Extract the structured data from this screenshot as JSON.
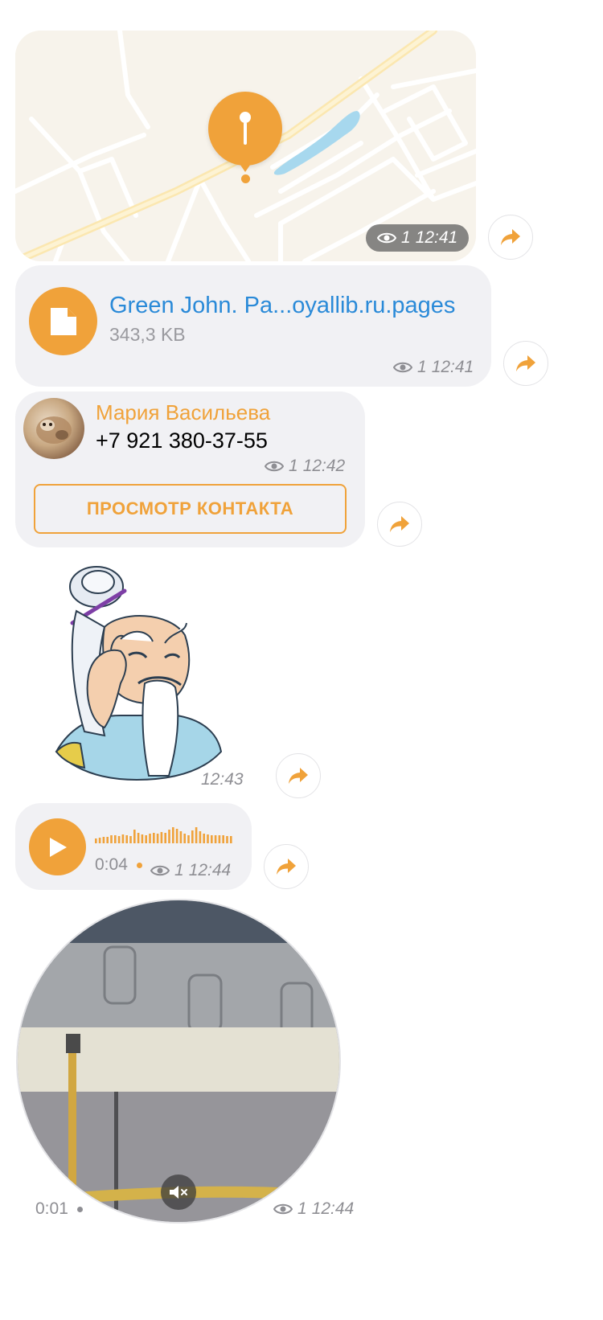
{
  "colors": {
    "accent": "#f0a23a",
    "link": "#2a8ad8",
    "bubble": "#f1f1f4",
    "meta": "#8e8e93"
  },
  "location_message": {
    "views": "1",
    "time": "12:41"
  },
  "file_message": {
    "file_name": "Green John. Pa...oyallib.ru.pages",
    "file_size": "343,3 KB",
    "views": "1",
    "time": "12:41",
    "icon": "document-icon"
  },
  "contact_message": {
    "name": "Мария Васильева",
    "phone": "+7 921 380-37-55",
    "views": "1",
    "time": "12:42",
    "view_contact_label": "ПРОСМОТР КОНТАКТА"
  },
  "sticker_message": {
    "time": "12:43"
  },
  "voice_message": {
    "duration": "0:04",
    "views": "1",
    "time": "12:44",
    "icon": "play-icon"
  },
  "video_message": {
    "duration": "0:01",
    "views": "1",
    "time": "12:44",
    "icon": "mute-icon"
  }
}
